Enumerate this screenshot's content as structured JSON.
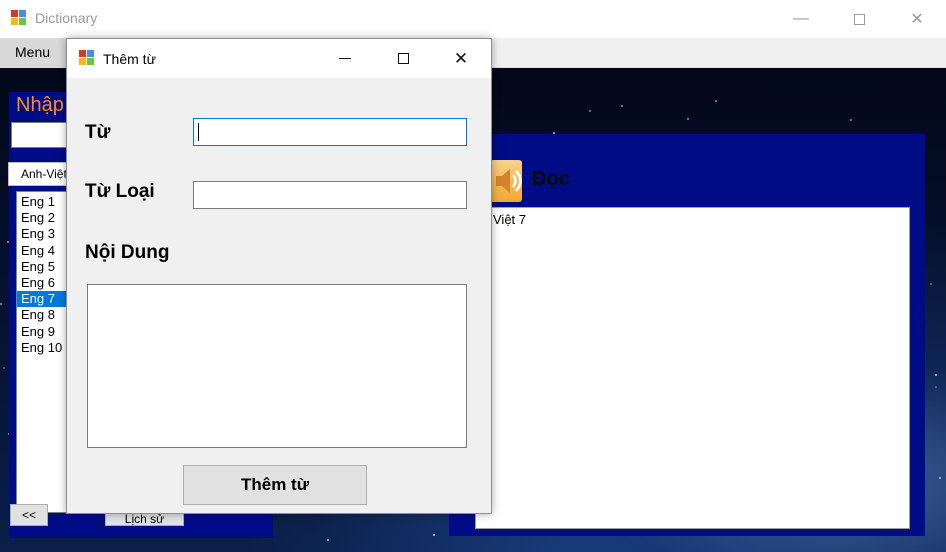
{
  "main_window": {
    "title": "Dictionary",
    "controls": {
      "minimize": "—",
      "maximize": "☐",
      "close": "✕"
    }
  },
  "menu": {
    "label": "Menu"
  },
  "left_panel": {
    "header_label": "Nhập",
    "search_value": "",
    "mode_select": "Anh-Việt",
    "words": [
      "Eng 1",
      "Eng 2",
      "Eng 3",
      "Eng 4",
      "Eng 5",
      "Eng 6",
      "Eng 7",
      "Eng 8",
      "Eng 9",
      "Eng 10"
    ],
    "selected_index": 6,
    "back_button": "<<",
    "history_button": "Lịch sử"
  },
  "right_panel": {
    "speak_label": "Đọc",
    "meaning_text": "Việt 7"
  },
  "dialog": {
    "title": "Thêm từ",
    "controls": {
      "minimize": "—",
      "maximize": "☐",
      "close": "✕"
    },
    "word_label": "Từ",
    "word_value": "",
    "type_label": "Từ Loại",
    "type_value": "",
    "content_label": "Nội Dung",
    "content_value": "",
    "submit_button": "Thêm từ"
  }
}
